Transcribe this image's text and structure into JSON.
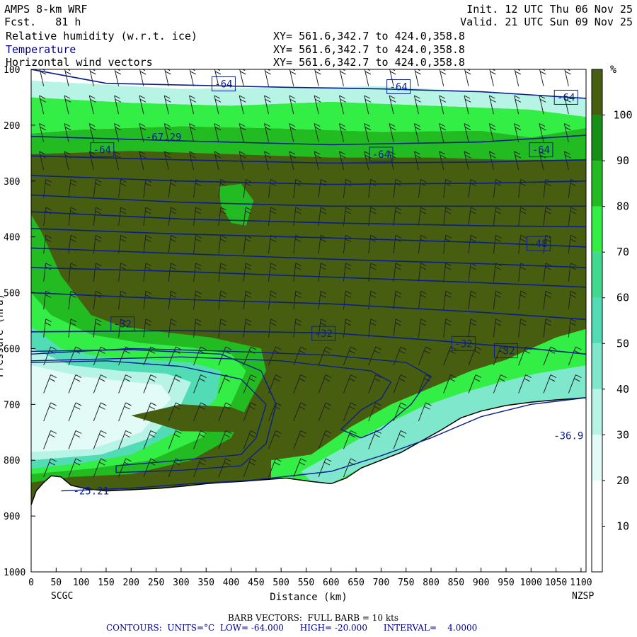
{
  "header": {
    "model": "AMPS 8-km WRF",
    "fcst": "Fcst.   81 h",
    "init": "Init. 12 UTC Thu 06 Nov 25",
    "valid": "Valid. 21 UTC Sun 09 Nov 25",
    "fields": [
      {
        "name": "Relative humidity (w.r.t. ice)",
        "xy": "XY= 561.6,342.7 to 424.0,358.8"
      },
      {
        "name": "Temperature",
        "xy": "XY= 561.6,342.7 to 424.0,358.8"
      },
      {
        "name": "Horizontal wind vectors",
        "xy": "XY= 561.6,342.7 to 424.0,358.8"
      }
    ]
  },
  "footer": {
    "barb": "BARB VECTORS:  FULL BARB = 10 kts",
    "contours": "CONTOURS:  UNITS=°C  LOW= -64.000      HIGH= -20.000      INTERVAL=    4.0000"
  },
  "chart_data": {
    "type": "heatmap",
    "xlabel": "Distance (km)",
    "ylabel": "Pressure (hPa)",
    "xlim": [
      0,
      1110
    ],
    "ylim": [
      1000,
      100
    ],
    "x_ticks": [
      0,
      50,
      100,
      150,
      200,
      250,
      300,
      350,
      400,
      450,
      500,
      550,
      600,
      650,
      700,
      750,
      800,
      850,
      900,
      950,
      1000,
      1050,
      1100
    ],
    "y_ticks": [
      100,
      200,
      300,
      400,
      500,
      600,
      700,
      800,
      900,
      1000
    ],
    "endpoints": {
      "left": "SCGC",
      "right": "NZSP"
    },
    "colorbar": {
      "unit": "%",
      "ticks": [
        10,
        20,
        30,
        40,
        50,
        60,
        70,
        80,
        90,
        100
      ],
      "colors": [
        "#ffffff",
        "#ffffff",
        "#e3fbf6",
        "#b8f4e6",
        "#7fe8cc",
        "#52dcb6",
        "#3fd98f",
        "#33ee44",
        "#22bb22",
        "#168f16",
        "#475e10"
      ]
    },
    "contour_labels": [
      {
        "text": "-64",
        "x": 385,
        "p": 126
      },
      {
        "text": "-64",
        "x": 735,
        "p": 131
      },
      {
        "text": "-64",
        "x": 1070,
        "p": 150
      },
      {
        "text": "-64",
        "x": 142,
        "p": 244
      },
      {
        "text": "-64",
        "x": 700,
        "p": 252
      },
      {
        "text": "-64",
        "x": 1020,
        "p": 244
      },
      {
        "text": "-67.29",
        "x": 265,
        "p": 221
      },
      {
        "text": "-48",
        "x": 1015,
        "p": 412
      },
      {
        "text": "-32",
        "x": 183,
        "p": 556
      },
      {
        "text": "-32",
        "x": 585,
        "p": 573
      },
      {
        "text": "-32",
        "x": 865,
        "p": 591
      },
      {
        "text": "-32",
        "x": 950,
        "p": 604
      },
      {
        "text": "-36.9",
        "x": 1075,
        "p": 756
      },
      {
        "text": "-25.21",
        "x": 120,
        "p": 855
      }
    ]
  }
}
